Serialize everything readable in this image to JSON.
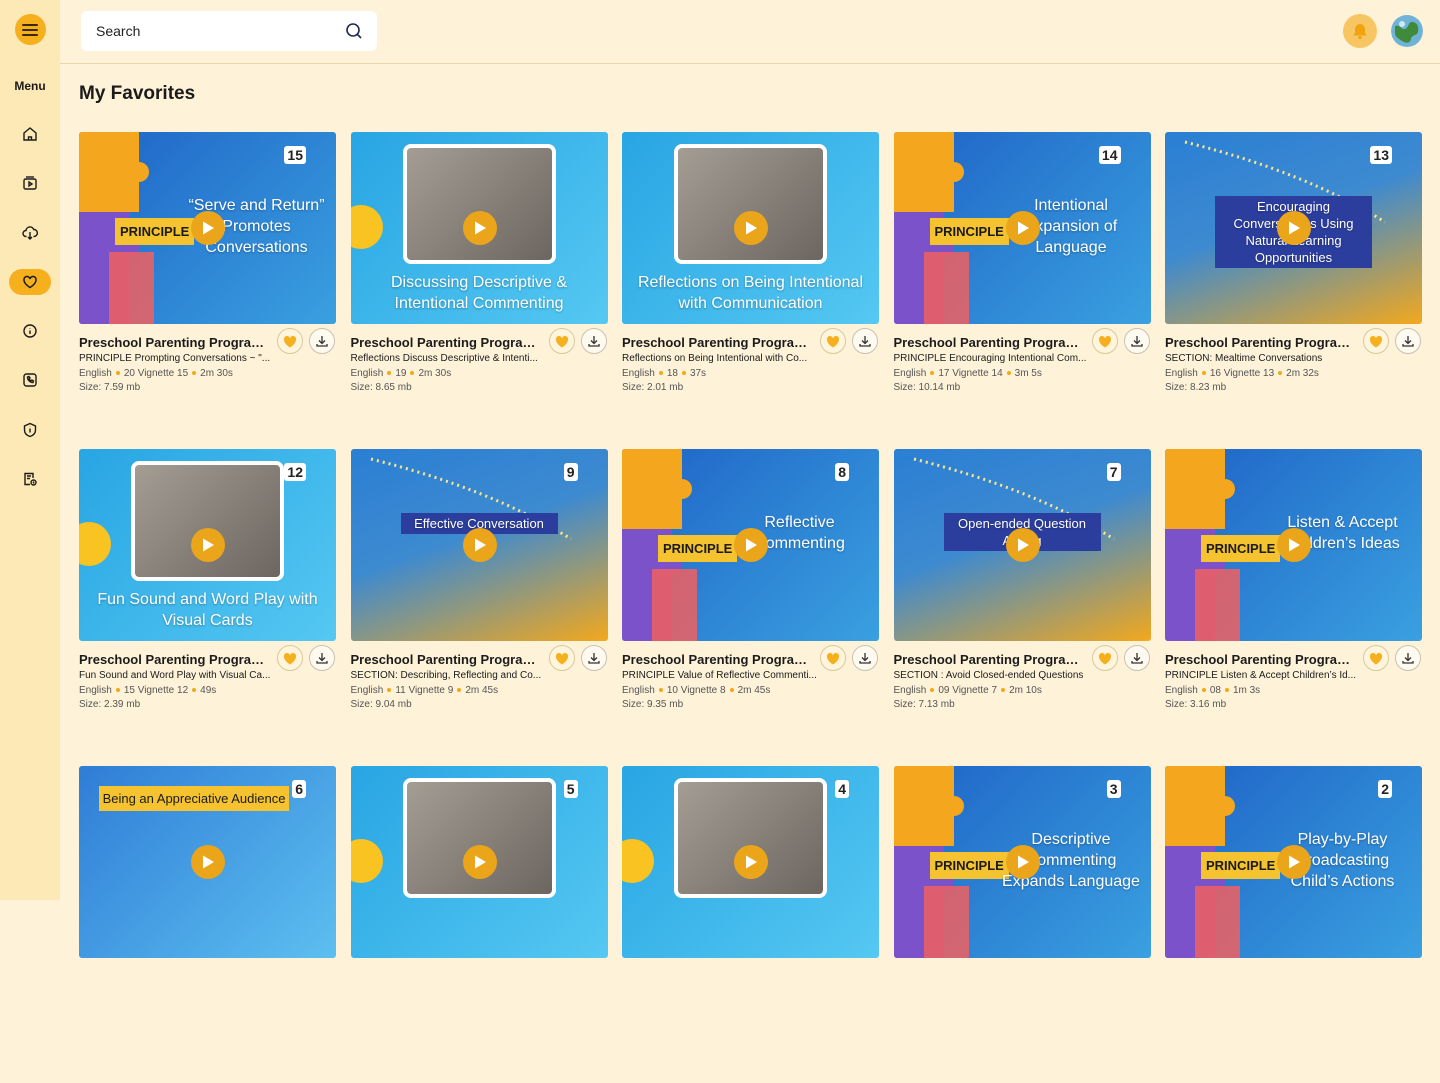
{
  "sidebar": {
    "menu_label": "Menu",
    "items": [
      {
        "name": "home-icon"
      },
      {
        "name": "library-icon"
      },
      {
        "name": "downloads-icon"
      },
      {
        "name": "favorites-icon",
        "active": true
      },
      {
        "name": "info-icon"
      },
      {
        "name": "contact-icon"
      },
      {
        "name": "privacy-icon"
      },
      {
        "name": "terms-icon"
      }
    ]
  },
  "search": {
    "placeholder": "Search"
  },
  "main": {
    "title": "My Favorites"
  },
  "colors": {
    "accent": "#f6b01e",
    "background": "#fef3d9",
    "sidebar": "#fde9b6"
  },
  "cards": [
    {
      "number": "15",
      "style": "puzzle",
      "principle": "PRINCIPLE",
      "thumb_text": "“Serve and Return” Promotes Conversations",
      "title": "Preschool Parenting Program ...",
      "subtitle": "PRINCIPLE Prompting Conversations ~ \"...",
      "language": "English",
      "vignette": "20 Vignette 15",
      "duration": "2m 30s",
      "size": "Size: 7.59 mb"
    },
    {
      "number": "",
      "style": "photo-sun",
      "principle": "",
      "thumb_text": "Discussing Descriptive & Intentional Commenting",
      "title": "Preschool Parenting Program ...",
      "subtitle": "Reflections Discuss Descriptive & Intenti...",
      "language": "English",
      "vignette": "19",
      "duration": "2m 30s",
      "size": "Size: 8.65 mb"
    },
    {
      "number": "",
      "style": "photo-blue",
      "principle": "",
      "thumb_text": "Reflections on Being Intentional with Communication",
      "title": "Preschool Parenting Program ...",
      "subtitle": "Reflections on Being Intentional with Co...",
      "language": "English",
      "vignette": "18",
      "duration": "37s",
      "size": "Size: 2.01 mb"
    },
    {
      "number": "14",
      "style": "puzzle",
      "principle": "PRINCIPLE",
      "thumb_text": "Intentional Expansion of Language",
      "title": "Preschool Parenting Program ...",
      "subtitle": "PRINCIPLE Encouraging Intentional Com...",
      "language": "English",
      "vignette": "17 Vignette 14",
      "duration": "3m 5s",
      "size": "Size: 10.14 mb"
    },
    {
      "number": "13",
      "style": "section",
      "principle": "",
      "thumb_text": "Encouraging Conversations Using Natural Learning Opportunities",
      "title": "Preschool Parenting Program ...",
      "subtitle": "SECTION: Mealtime Conversations",
      "language": "English",
      "vignette": "16 Vignette 13",
      "duration": "2m 32s",
      "size": "Size: 8.23 mb"
    },
    {
      "number": "12",
      "style": "photo-sun",
      "principle": "",
      "thumb_text": "Fun Sound and Word Play with Visual Cards",
      "title": "Preschool Parenting Program ...",
      "subtitle": "Fun Sound and Word Play with Visual Ca...",
      "language": "English",
      "vignette": "15 Vignette 12",
      "duration": "49s",
      "size": "Size: 2.39 mb"
    },
    {
      "number": "9",
      "style": "section",
      "principle": "",
      "thumb_text": "Effective Conversation",
      "title": "Preschool Parenting Program ...",
      "subtitle": "SECTION: Describing, Reflecting and Co...",
      "language": "English",
      "vignette": "11 Vignette 9",
      "duration": "2m 45s",
      "size": "Size: 9.04 mb"
    },
    {
      "number": "8",
      "style": "puzzle",
      "principle": "PRINCIPLE",
      "thumb_text": "Reflective Commenting",
      "title": "Preschool Parenting Program ...",
      "subtitle": "PRINCIPLE Value of Reflective Commenti...",
      "language": "English",
      "vignette": "10 Vignette 8",
      "duration": "2m 45s",
      "size": "Size: 9.35 mb"
    },
    {
      "number": "7",
      "style": "section",
      "principle": "",
      "thumb_text": "Open-ended Question Asking",
      "title": "Preschool Parenting Program ...",
      "subtitle": "SECTION : Avoid Closed-ended Questions",
      "language": "English",
      "vignette": "09 Vignette 7",
      "duration": "2m 10s",
      "size": "Size: 7.13 mb"
    },
    {
      "number": "",
      "style": "puzzle",
      "principle": "PRINCIPLE",
      "thumb_text": "Listen & Accept Children’s Ideas",
      "title": "Preschool Parenting Program ...",
      "subtitle": "PRINCIPLE Listen & Accept Children’s Id...",
      "language": "English",
      "vignette": "08",
      "duration": "1m 3s",
      "size": "Size: 3.16 mb"
    },
    {
      "number": "6",
      "style": "audience",
      "principle": "",
      "thumb_text": "Being an Appreciative Audience",
      "title": "",
      "subtitle": "",
      "language": "",
      "vignette": "",
      "duration": "",
      "size": ""
    },
    {
      "number": "5",
      "style": "photo-sun",
      "principle": "",
      "thumb_text": "",
      "title": "",
      "subtitle": "",
      "language": "",
      "vignette": "",
      "duration": "",
      "size": ""
    },
    {
      "number": "4",
      "style": "photo-sun",
      "principle": "",
      "thumb_text": "",
      "title": "",
      "subtitle": "",
      "language": "",
      "vignette": "",
      "duration": "",
      "size": ""
    },
    {
      "number": "3",
      "style": "puzzle",
      "principle": "PRINCIPLE",
      "thumb_text": "Descriptive Commenting Expands Language",
      "title": "",
      "subtitle": "",
      "language": "",
      "vignette": "",
      "duration": "",
      "size": ""
    },
    {
      "number": "2",
      "style": "puzzle",
      "principle": "PRINCIPLE",
      "thumb_text": "Play-by-Play Broadcasting Child’s Actions",
      "title": "",
      "subtitle": "",
      "language": "",
      "vignette": "",
      "duration": "",
      "size": ""
    }
  ]
}
